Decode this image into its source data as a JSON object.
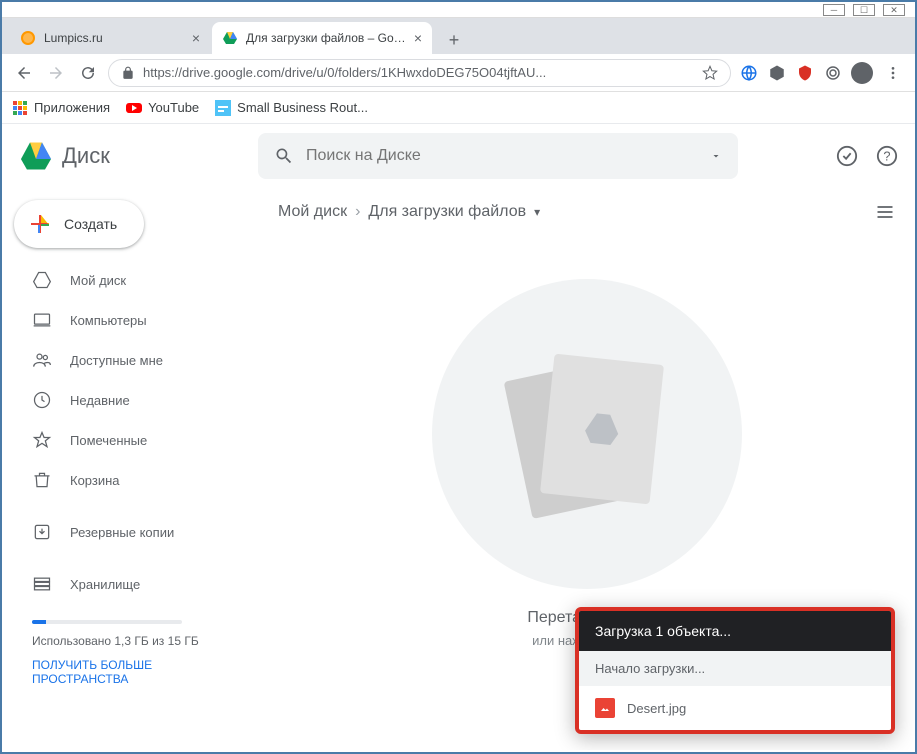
{
  "window": {
    "tabs": [
      {
        "title": "Lumpics.ru",
        "favicon": "orange"
      },
      {
        "title": "Для загрузки файлов – Google Д",
        "favicon": "drive"
      }
    ],
    "url": "https://drive.google.com/drive/u/0/folders/1KHwxdoDEG75O04tjftAU..."
  },
  "bookmarks": [
    {
      "label": "Приложения",
      "icon": "apps"
    },
    {
      "label": "YouTube",
      "icon": "youtube"
    },
    {
      "label": "Small Business Rout...",
      "icon": "generic"
    }
  ],
  "drive": {
    "logo_text": "Диск",
    "search_placeholder": "Поиск на Диске",
    "create_label": "Создать",
    "sidebar": [
      {
        "label": "Мой диск",
        "icon": "mydrive"
      },
      {
        "label": "Компьютеры",
        "icon": "computers"
      },
      {
        "label": "Доступные мне",
        "icon": "shared"
      },
      {
        "label": "Недавние",
        "icon": "recent"
      },
      {
        "label": "Помеченные",
        "icon": "starred"
      },
      {
        "label": "Корзина",
        "icon": "trash"
      }
    ],
    "backups_label": "Резервные копии",
    "storage": {
      "label": "Хранилище",
      "used_text": "Использовано 1,3 ГБ из 15 ГБ",
      "upgrade_text": "ПОЛУЧИТЬ БОЛЬШЕ ПРОСТРАНСТВА"
    },
    "breadcrumb": {
      "root": "Мой диск",
      "current": "Для загрузки файлов"
    },
    "empty": {
      "title": "Перетащите фа",
      "subtitle": "или нажмите кноп"
    },
    "upload": {
      "header": "Загрузка 1 объекта...",
      "status": "Начало загрузки...",
      "file_name": "Desert.jpg"
    }
  }
}
